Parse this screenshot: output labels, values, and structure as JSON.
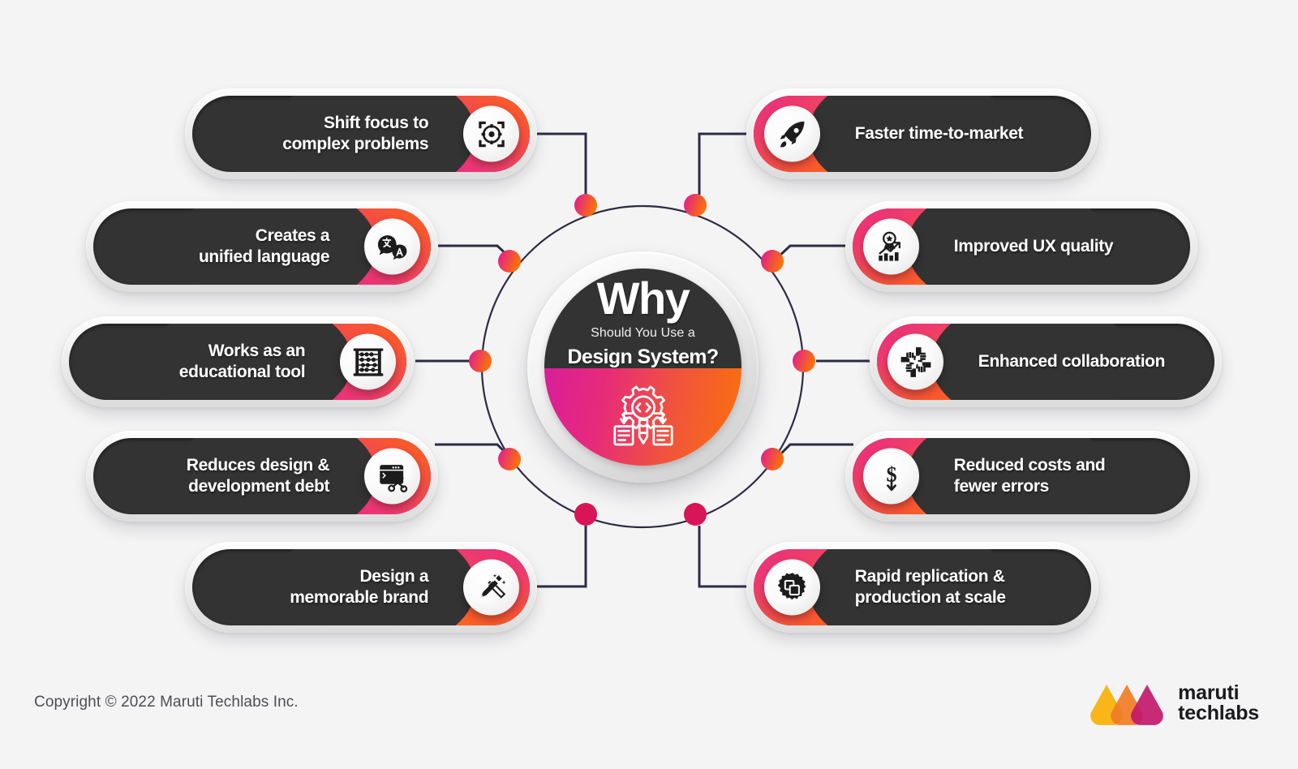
{
  "background_color": "#f4f4f5",
  "hub": {
    "why": "Why",
    "subtitle": "Should You Use a",
    "title": "Design System?",
    "icon": "gear-code-workflow-icon",
    "top_color": "#333333",
    "gradient_from": "#d81e9a",
    "gradient_to": "#fa7208"
  },
  "accent": {
    "pink": "#e0169a",
    "magenta": "#d81557",
    "orange": "#ff8a00",
    "line": "#2b2b44"
  },
  "left_items": [
    {
      "label": "Shift focus to\ncomplex problems",
      "icon": "target-focus-icon"
    },
    {
      "label": "Creates a\nunified language",
      "icon": "translate-language-icon"
    },
    {
      "label": "Works as an\neducational tool",
      "icon": "abacus-icon"
    },
    {
      "label": "Reduces design &\ndevelopment debt",
      "icon": "window-scissors-icon"
    },
    {
      "label": "Design a\nmemorable brand",
      "icon": "magic-pen-icon"
    }
  ],
  "right_items": [
    {
      "label": "Faster time-to-market",
      "icon": "rocket-icon"
    },
    {
      "label": "Improved UX quality",
      "icon": "award-chart-icon"
    },
    {
      "label": "Enhanced collaboration",
      "icon": "collaboration-hands-icon"
    },
    {
      "label": "Reduced costs and\nfewer errors",
      "icon": "dollar-down-icon"
    },
    {
      "label": "Rapid replication &\nproduction at scale",
      "icon": "gear-copy-icon"
    }
  ],
  "footer": {
    "copyright": "Copyright © 2022 Maruti Techlabs Inc.",
    "brand_line1": "maruti",
    "brand_line2": "techlabs",
    "logo": "maruti-techlabs-logo"
  }
}
